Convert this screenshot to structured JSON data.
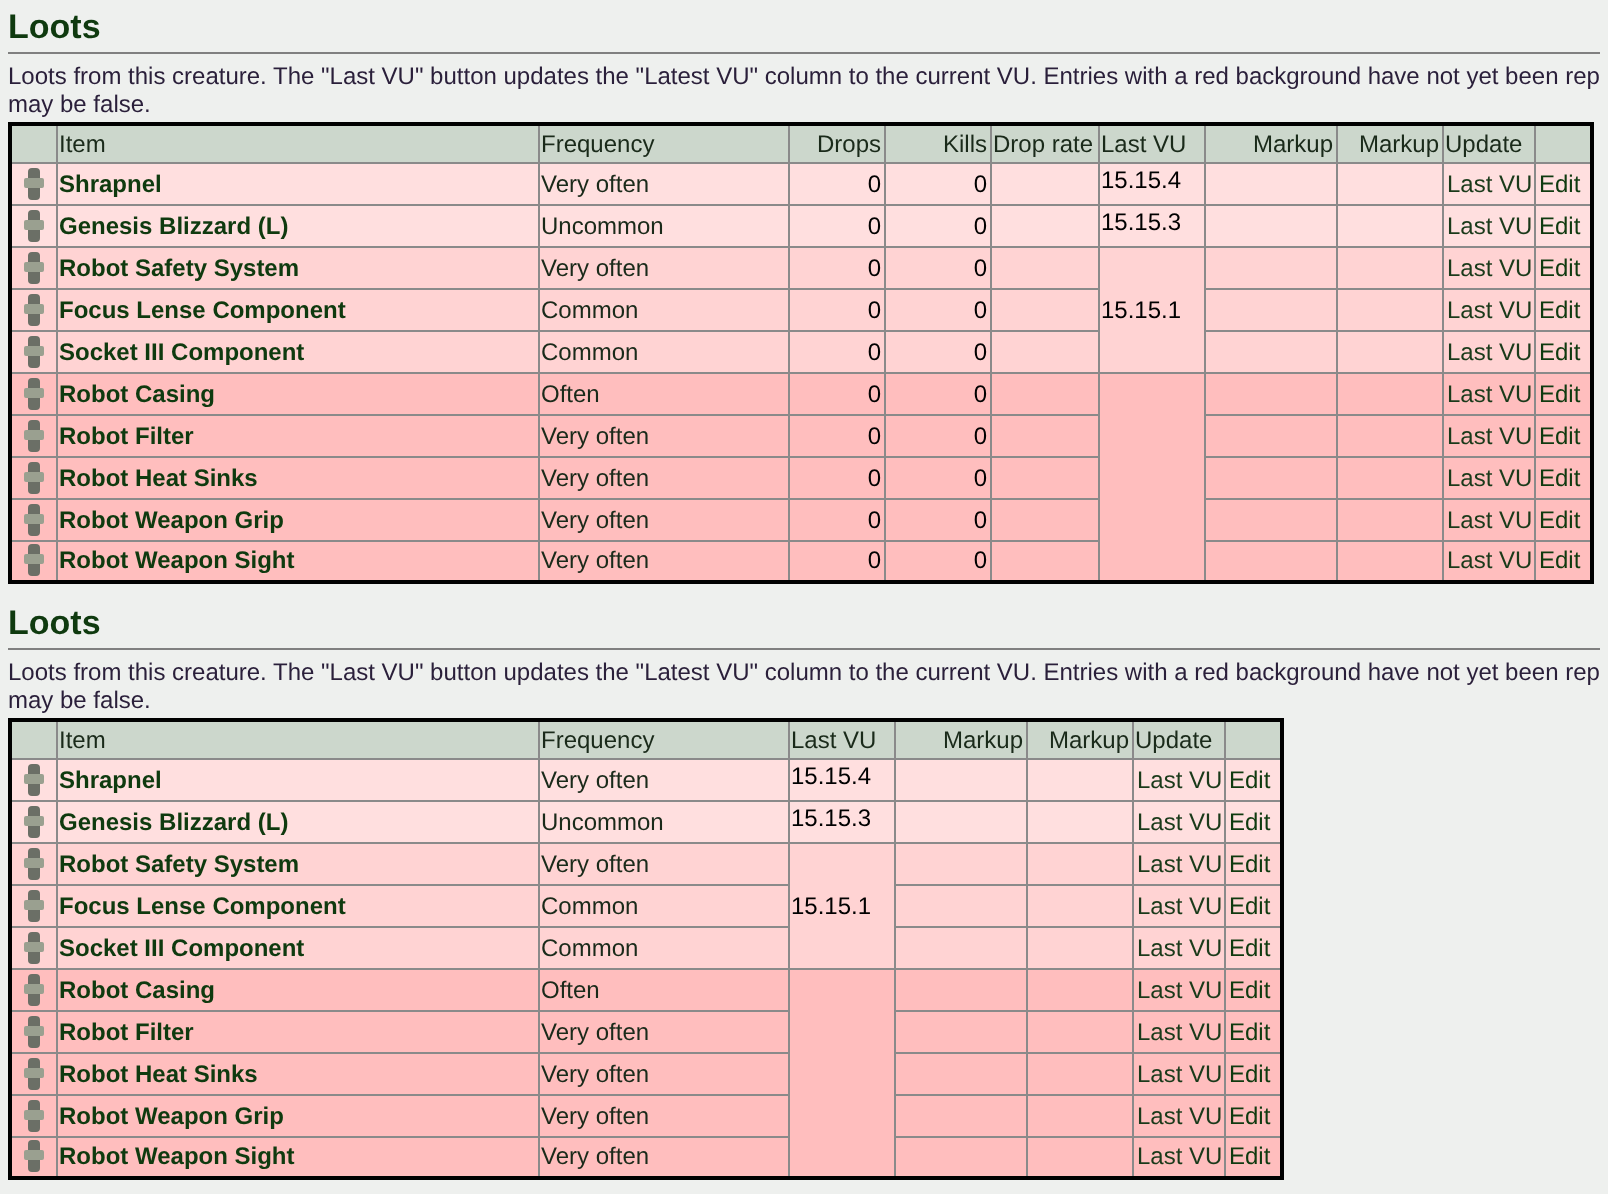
{
  "panels": [
    {
      "title": "Loots",
      "description_lines": [
        "Loots from this creature. The \"Last VU\" button updates the \"Latest VU\" column to the current VU. Entries with a red background have not yet been rep",
        "may be false."
      ],
      "columns": [
        {
          "kind": "icon"
        },
        {
          "kind": "item",
          "label": "Item"
        },
        {
          "kind": "frequency",
          "label": "Frequency"
        },
        {
          "kind": "drops",
          "label": "Drops"
        },
        {
          "kind": "kills",
          "label": "Kills"
        },
        {
          "kind": "drop_rate",
          "label": "Drop rate"
        },
        {
          "kind": "last_vu",
          "label": "Last VU"
        },
        {
          "kind": "markup",
          "label": "Markup"
        },
        {
          "kind": "markup",
          "label": "Markup"
        },
        {
          "kind": "update",
          "label": "Update"
        },
        {
          "kind": "edit"
        }
      ],
      "vu_groups": [
        {
          "last_vu": "15.15.4",
          "color": "#ffdfdf",
          "rows": [
            {
              "item": "Shrapnel",
              "frequency": "Very often",
              "drops": "0",
              "kills": "0",
              "update": "Last VU",
              "edit": "Edit"
            }
          ]
        },
        {
          "last_vu": "15.15.3",
          "color": "#ffdfdf",
          "rows": [
            {
              "item": "Genesis Blizzard (L)",
              "frequency": "Uncommon",
              "drops": "0",
              "kills": "0",
              "update": "Last VU",
              "edit": "Edit"
            }
          ]
        },
        {
          "last_vu": "15.15.1",
          "color": "#ffd3d3",
          "rows": [
            {
              "item": "Robot Safety System",
              "frequency": "Very often",
              "drops": "0",
              "kills": "0",
              "update": "Last VU",
              "edit": "Edit"
            },
            {
              "item": "Focus Lense Component",
              "frequency": "Common",
              "drops": "0",
              "kills": "0",
              "update": "Last VU",
              "edit": "Edit"
            },
            {
              "item": "Socket III Component",
              "frequency": "Common",
              "drops": "0",
              "kills": "0",
              "update": "Last VU",
              "edit": "Edit"
            }
          ]
        },
        {
          "color": "#ffbebe",
          "rows": [
            {
              "item": "Robot Casing",
              "frequency": "Often",
              "drops": "0",
              "kills": "0",
              "update": "Last VU",
              "edit": "Edit"
            },
            {
              "item": "Robot Filter",
              "frequency": "Very often",
              "drops": "0",
              "kills": "0",
              "update": "Last VU",
              "edit": "Edit"
            },
            {
              "item": "Robot Heat Sinks",
              "frequency": "Very often",
              "drops": "0",
              "kills": "0",
              "update": "Last VU",
              "edit": "Edit"
            },
            {
              "item": "Robot Weapon Grip",
              "frequency": "Very often",
              "drops": "0",
              "kills": "0",
              "update": "Last VU",
              "edit": "Edit"
            },
            {
              "item": "Robot Weapon Sight",
              "frequency": "Very often",
              "drops": "0",
              "kills": "0",
              "update": "Last VU",
              "edit": "Edit"
            }
          ]
        }
      ]
    },
    {
      "title": "Loots",
      "description_lines": [
        "Loots from this creature. The \"Last VU\" button updates the \"Latest VU\" column to the current VU. Entries with a red background have not yet been rep",
        "may be false."
      ],
      "columns": [
        {
          "kind": "icon"
        },
        {
          "kind": "item",
          "label": "Item"
        },
        {
          "kind": "frequency",
          "label": "Frequency"
        },
        {
          "kind": "last_vu",
          "label": "Last VU"
        },
        {
          "kind": "markup",
          "label": "Markup"
        },
        {
          "kind": "markup",
          "label": "Markup"
        },
        {
          "kind": "update",
          "label": "Update"
        },
        {
          "kind": "edit"
        }
      ],
      "vu_groups": [
        {
          "last_vu": "15.15.4",
          "color": "#ffdfdf",
          "rows": [
            {
              "item": "Shrapnel",
              "frequency": "Very often",
              "update": "Last VU",
              "edit": "Edit"
            }
          ]
        },
        {
          "last_vu": "15.15.3",
          "color": "#ffdfdf",
          "rows": [
            {
              "item": "Genesis Blizzard (L)",
              "frequency": "Uncommon",
              "update": "Last VU",
              "edit": "Edit"
            }
          ]
        },
        {
          "last_vu": "15.15.1",
          "color": "#ffd3d3",
          "rows": [
            {
              "item": "Robot Safety System",
              "frequency": "Very often",
              "update": "Last VU",
              "edit": "Edit"
            },
            {
              "item": "Focus Lense Component",
              "frequency": "Common",
              "update": "Last VU",
              "edit": "Edit"
            },
            {
              "item": "Socket III Component",
              "frequency": "Common",
              "update": "Last VU",
              "edit": "Edit"
            }
          ]
        },
        {
          "color": "#ffbebe",
          "rows": [
            {
              "item": "Robot Casing",
              "frequency": "Often",
              "update": "Last VU",
              "edit": "Edit"
            },
            {
              "item": "Robot Filter",
              "frequency": "Very often",
              "update": "Last VU",
              "edit": "Edit"
            },
            {
              "item": "Robot Heat Sinks",
              "frequency": "Very often",
              "update": "Last VU",
              "edit": "Edit"
            },
            {
              "item": "Robot Weapon Grip",
              "frequency": "Very often",
              "update": "Last VU",
              "edit": "Edit"
            },
            {
              "item": "Robot Weapon Sight",
              "frequency": "Very often",
              "update": "Last VU",
              "edit": "Edit"
            }
          ]
        }
      ]
    }
  ]
}
